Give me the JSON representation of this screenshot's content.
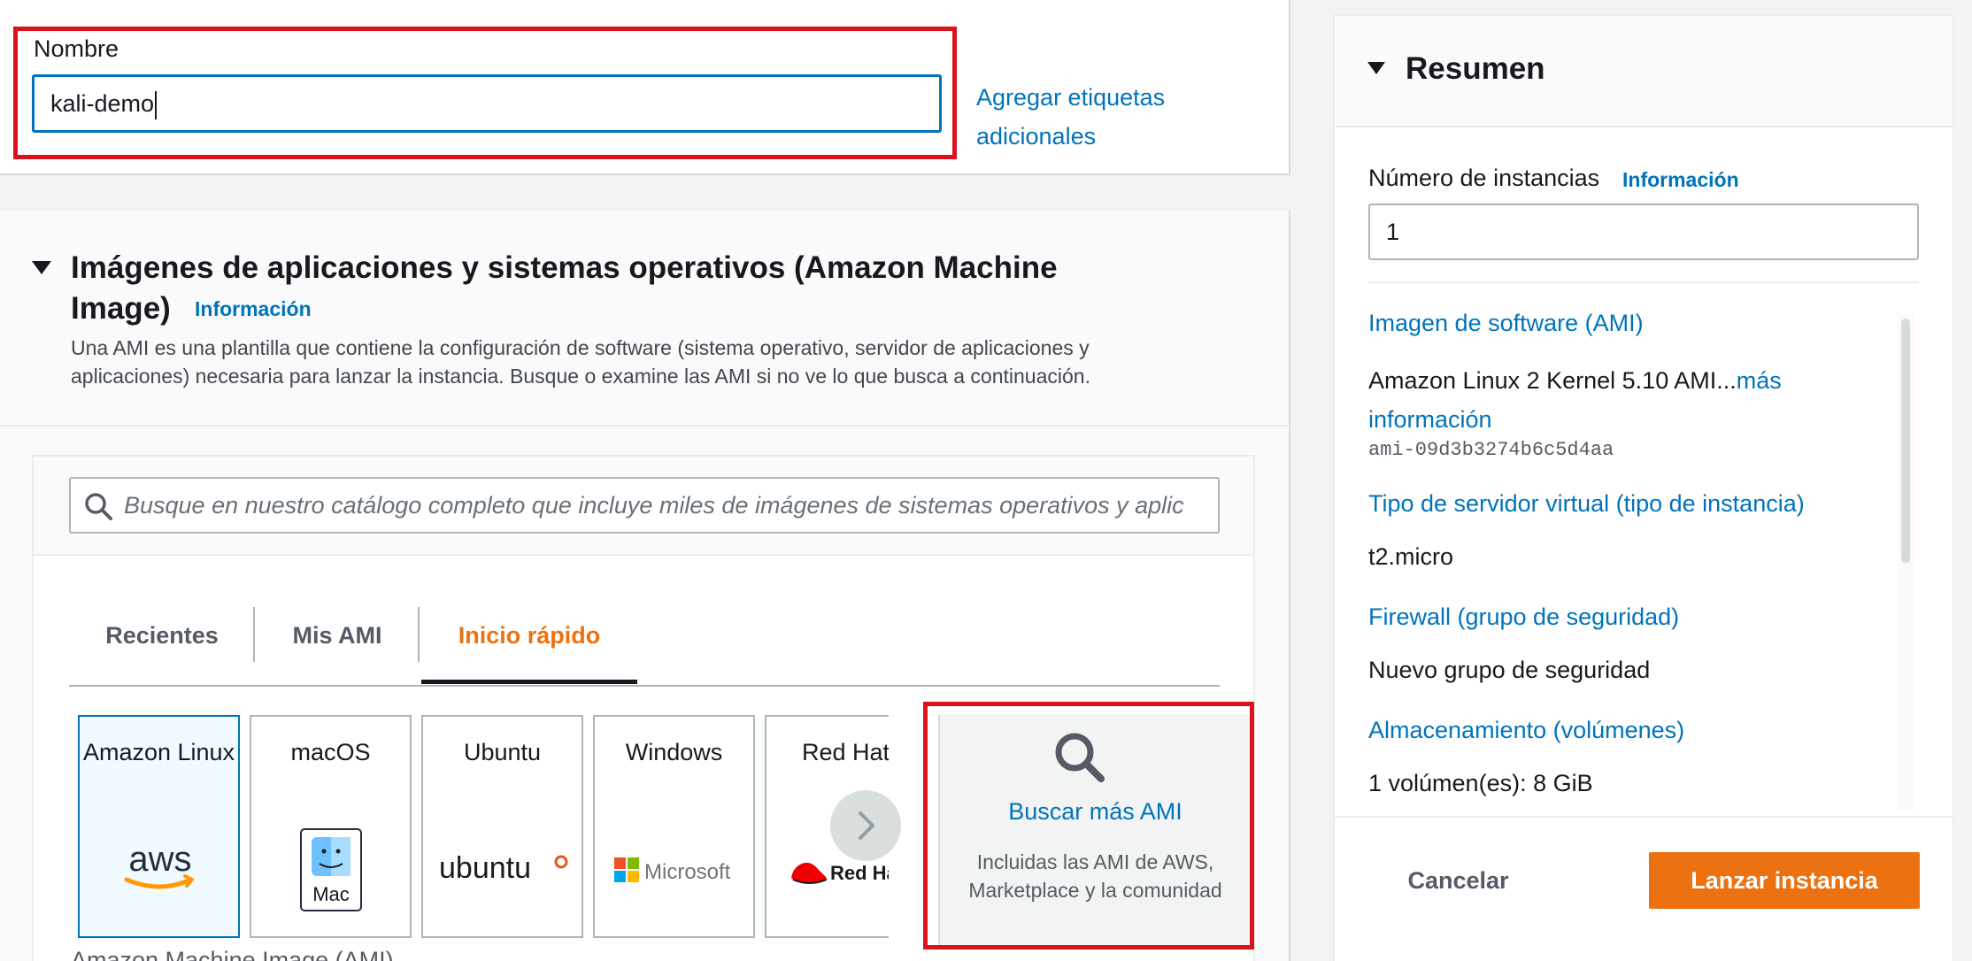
{
  "name_section": {
    "label": "Nombre",
    "value": "kali-demo",
    "add_tags_link": "Agregar etiquetas adicionales"
  },
  "ami_section": {
    "title": "Imágenes de aplicaciones y sistemas operativos (Amazon Machine Image)",
    "info_link": "Información",
    "description": "Una AMI es una plantilla que contiene la configuración de software (sistema operativo, servidor de aplicaciones y aplicaciones) necesaria para lanzar la instancia. Busque o examine las AMI si no ve lo que busca a continuación.",
    "search_placeholder": "Busque en nuestro catálogo completo que incluye miles de imágenes de sistemas operativos y aplic",
    "tabs": [
      {
        "label": "Recientes",
        "active": false
      },
      {
        "label": "Mis AMI",
        "active": false
      },
      {
        "label": "Inicio rápido",
        "active": true
      }
    ],
    "quickstart_cards": [
      {
        "label": "Amazon Linux",
        "logo": "aws",
        "selected": true
      },
      {
        "label": "macOS",
        "logo": "Mac",
        "selected": false
      },
      {
        "label": "Ubuntu",
        "logo": "ubuntu",
        "selected": false
      },
      {
        "label": "Windows",
        "logo": "Microsoft",
        "selected": false
      },
      {
        "label": "Red Hat",
        "logo": "Red Hat",
        "selected": false
      }
    ],
    "browse_more": {
      "title": "Buscar más AMI",
      "description": "Incluidas las AMI de AWS, Marketplace y la comunidad"
    },
    "footer_label": "Amazon Machine Image (AMI)"
  },
  "summary": {
    "title": "Resumen",
    "instances_label": "Número de instancias",
    "instances_info": "Información",
    "instances_value": "1",
    "software_image_label": "Imagen de software (AMI)",
    "software_image_value": "Amazon Linux 2 Kernel 5.10 AMI...",
    "software_image_more": "más información",
    "ami_id": "ami-09d3b3274b6c5d4aa",
    "server_type_label": "Tipo de servidor virtual (tipo de instancia)",
    "server_type_value": "t2.micro",
    "firewall_label": "Firewall (grupo de seguridad)",
    "firewall_value": "Nuevo grupo de seguridad",
    "storage_label": "Almacenamiento (volúmenes)",
    "storage_value": "1 volúmen(es): 8 GiB",
    "cancel_label": "Cancelar",
    "launch_label": "Lanzar instancia"
  },
  "colors": {
    "link": "#0073bb",
    "accent_orange": "#ec7211",
    "highlight_red": "#d9121c",
    "text": "#16191f"
  }
}
